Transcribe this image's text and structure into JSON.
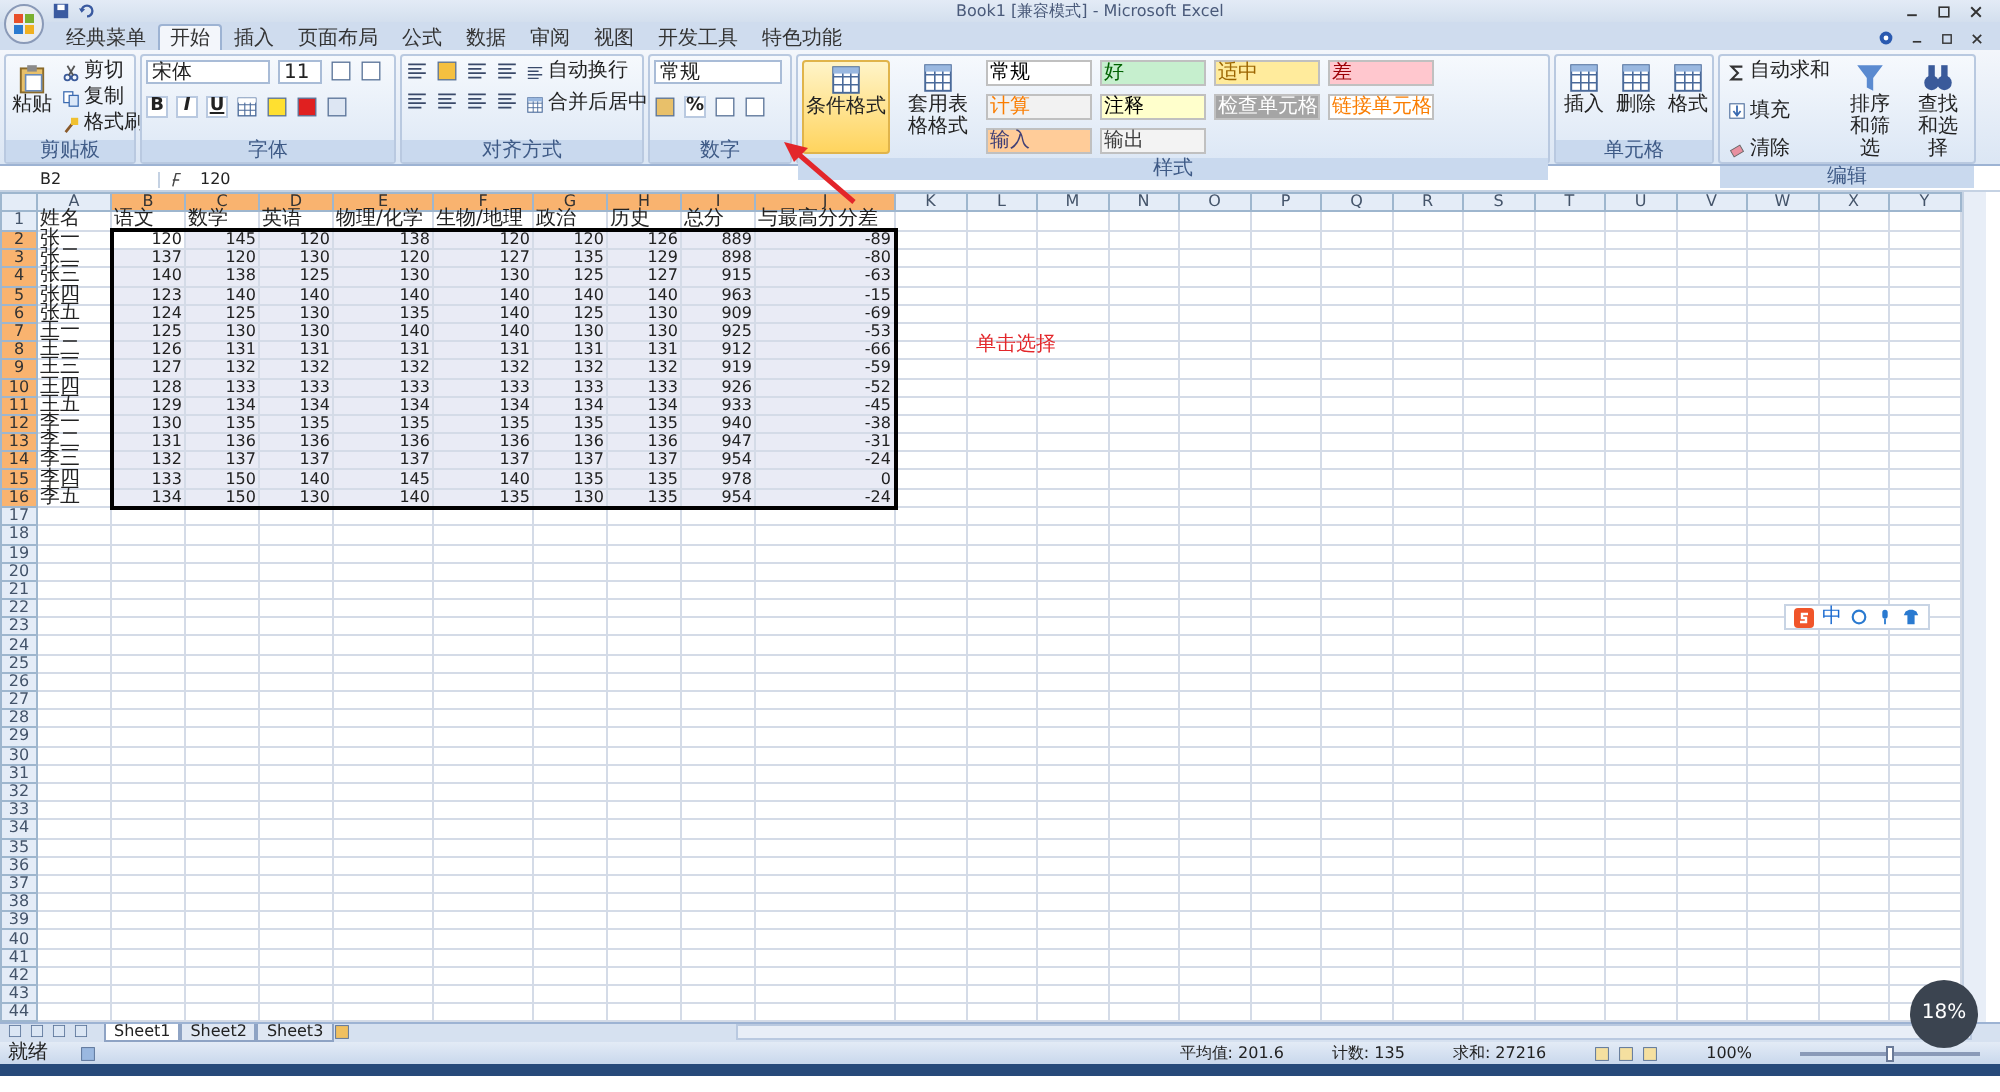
{
  "window": {
    "title": "Book1 [兼容模式] - Microsoft Excel"
  },
  "ribbon_tabs": [
    {
      "label": "经典菜单",
      "selected": false
    },
    {
      "label": "开始",
      "selected": true
    },
    {
      "label": "插入",
      "selected": false
    },
    {
      "label": "页面布局",
      "selected": false
    },
    {
      "label": "公式",
      "selected": false
    },
    {
      "label": "数据",
      "selected": false
    },
    {
      "label": "审阅",
      "selected": false
    },
    {
      "label": "视图",
      "selected": false
    },
    {
      "label": "开发工具",
      "selected": false
    },
    {
      "label": "特色功能",
      "selected": false
    }
  ],
  "clipboard": {
    "paste": "粘贴",
    "small_buttons": [
      "剪切",
      "复制",
      "格式刷"
    ],
    "label": "剪贴板"
  },
  "font": {
    "font_name": "宋体",
    "font_size": "11",
    "style_buttons": [
      "B",
      "I",
      "U"
    ],
    "label": "字体"
  },
  "alignment": {
    "wrap": "自动换行",
    "merge": "合并后居中",
    "label": "对齐方式"
  },
  "number": {
    "format": "常规",
    "percent": "%",
    "label": "数字"
  },
  "styles": {
    "big_buttons": [
      {
        "label": "条件格式",
        "selected": true
      },
      {
        "label": "套用表格格式",
        "selected": false
      }
    ],
    "cell_styles": [
      {
        "label": "常规",
        "color": "#ffffff"
      },
      {
        "label": "好",
        "color": "#c6efce"
      },
      {
        "label": "适中",
        "color": "#ffeb9c"
      },
      {
        "label": "差",
        "color": "#ffc7ce"
      },
      {
        "label": "计算",
        "color": "#f2f2f2"
      },
      {
        "label": "注释",
        "color": "#ffffcc"
      },
      {
        "label": "检查单元格",
        "color": "#a5a5a5"
      },
      {
        "label": "链接单元格",
        "color": "#fffffe"
      },
      {
        "label": "输入",
        "color": "#ffcc99"
      },
      {
        "label": "输出",
        "color": "#f3f3f3"
      }
    ],
    "label": "样式"
  },
  "cells_group": {
    "buttons": [
      "插入",
      "删除",
      "格式"
    ],
    "label": "单元格"
  },
  "editing": {
    "small_buttons": [
      "自动求和",
      "填充",
      "清除"
    ],
    "big_buttons": [
      "排序和筛选",
      "查找和选择"
    ],
    "label": "编辑"
  },
  "formula_bar": {
    "name_box": "B2",
    "value": "120"
  },
  "columns": [
    {
      "label": "A",
      "selected": false
    },
    {
      "label": "B",
      "selected": true
    },
    {
      "label": "C",
      "selected": true
    },
    {
      "label": "D",
      "selected": true
    },
    {
      "label": "E",
      "selected": true
    },
    {
      "label": "F",
      "selected": true
    },
    {
      "label": "G",
      "selected": true
    },
    {
      "label": "H",
      "selected": true
    },
    {
      "label": "I",
      "selected": true
    },
    {
      "label": "J",
      "selected": true
    },
    {
      "label": "K",
      "selected": false
    },
    {
      "label": "L",
      "selected": false
    },
    {
      "label": "M",
      "selected": false
    },
    {
      "label": "N",
      "selected": false
    },
    {
      "label": "O",
      "selected": false
    },
    {
      "label": "P",
      "selected": false
    },
    {
      "label": "Q",
      "selected": false
    },
    {
      "label": "R",
      "selected": false
    },
    {
      "label": "S",
      "selected": false
    },
    {
      "label": "T",
      "selected": false
    },
    {
      "label": "U",
      "selected": false
    },
    {
      "label": "V",
      "selected": false
    },
    {
      "label": "W",
      "selected": false
    },
    {
      "label": "X",
      "selected": false
    },
    {
      "label": "Y",
      "selected": false
    }
  ],
  "rows": [
    {
      "header": "1",
      "selected": false,
      "cells": [
        "姓名",
        "语文",
        "数学",
        "英语",
        "物理/化学",
        "生物/地理",
        "政治",
        "历史",
        "总分",
        "与最高分分差"
      ]
    },
    {
      "header": "2",
      "selected": true,
      "cells": [
        "张一",
        "120",
        "145",
        "120",
        "138",
        "120",
        "120",
        "126",
        "889",
        "-89"
      ]
    },
    {
      "header": "3",
      "selected": true,
      "cells": [
        "张二",
        "137",
        "120",
        "130",
        "120",
        "127",
        "135",
        "129",
        "898",
        "-80"
      ]
    },
    {
      "header": "4",
      "selected": true,
      "cells": [
        "张三",
        "140",
        "138",
        "125",
        "130",
        "130",
        "125",
        "127",
        "915",
        "-63"
      ]
    },
    {
      "header": "5",
      "selected": true,
      "cells": [
        "张四",
        "123",
        "140",
        "140",
        "140",
        "140",
        "140",
        "140",
        "963",
        "-15"
      ]
    },
    {
      "header": "6",
      "selected": true,
      "cells": [
        "张五",
        "124",
        "125",
        "130",
        "135",
        "140",
        "125",
        "130",
        "909",
        "-69"
      ]
    },
    {
      "header": "7",
      "selected": true,
      "cells": [
        "王一",
        "125",
        "130",
        "130",
        "140",
        "140",
        "130",
        "130",
        "925",
        "-53"
      ]
    },
    {
      "header": "8",
      "selected": true,
      "cells": [
        "王二",
        "126",
        "131",
        "131",
        "131",
        "131",
        "131",
        "131",
        "912",
        "-66"
      ]
    },
    {
      "header": "9",
      "selected": true,
      "cells": [
        "王三",
        "127",
        "132",
        "132",
        "132",
        "132",
        "132",
        "132",
        "919",
        "-59"
      ]
    },
    {
      "header": "10",
      "selected": true,
      "cells": [
        "王四",
        "128",
        "133",
        "133",
        "133",
        "133",
        "133",
        "133",
        "926",
        "-52"
      ]
    },
    {
      "header": "11",
      "selected": true,
      "cells": [
        "王五",
        "129",
        "134",
        "134",
        "134",
        "134",
        "134",
        "134",
        "933",
        "-45"
      ]
    },
    {
      "header": "12",
      "selected": true,
      "cells": [
        "李一",
        "130",
        "135",
        "135",
        "135",
        "135",
        "135",
        "135",
        "940",
        "-38"
      ]
    },
    {
      "header": "13",
      "selected": true,
      "cells": [
        "李二",
        "131",
        "136",
        "136",
        "136",
        "136",
        "136",
        "136",
        "947",
        "-31"
      ]
    },
    {
      "header": "14",
      "selected": true,
      "cells": [
        "李三",
        "132",
        "137",
        "137",
        "137",
        "137",
        "137",
        "137",
        "954",
        "-24"
      ]
    },
    {
      "header": "15",
      "selected": true,
      "cells": [
        "李四",
        "133",
        "150",
        "140",
        "145",
        "140",
        "135",
        "135",
        "978",
        "0"
      ]
    },
    {
      "header": "16",
      "selected": true,
      "cells": [
        "李五",
        "134",
        "150",
        "130",
        "140",
        "135",
        "130",
        "135",
        "954",
        "-24"
      ]
    }
  ],
  "blank_rows": [
    "17",
    "18",
    "19",
    "20",
    "21",
    "22",
    "23",
    "24",
    "25",
    "26",
    "27",
    "28",
    "29",
    "30",
    "31",
    "32",
    "33",
    "34",
    "35",
    "36",
    "37",
    "38",
    "39",
    "40",
    "41",
    "42",
    "43",
    "44"
  ],
  "sheet_tabs": [
    {
      "label": "Sheet1",
      "selected": true
    },
    {
      "label": "Sheet2",
      "selected": false
    },
    {
      "label": "Sheet3",
      "selected": false
    }
  ],
  "status_bar": {
    "mode": "就绪",
    "average": "平均值: 201.6",
    "count": "计数: 135",
    "sum": "求和: 27216",
    "zoom": "100%",
    "zoom_level": {
      "level": 0.5
    }
  },
  "annotation": {
    "text": "单击选择"
  },
  "ime_toolbar": {
    "mode": "中"
  },
  "speed_widget": {
    "percent": "18%"
  }
}
